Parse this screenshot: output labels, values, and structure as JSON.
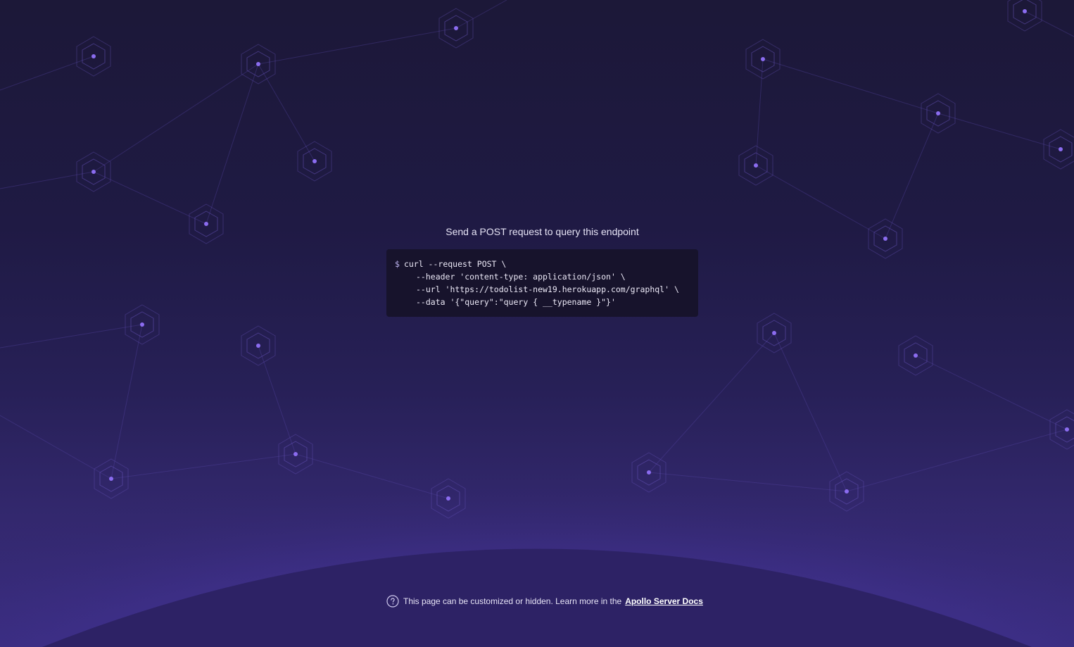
{
  "main": {
    "headline": "Send a POST request to query this endpoint",
    "code": {
      "prompt": "$",
      "lines": [
        "curl --request POST \\",
        "--header 'content-type: application/json' \\",
        "--url 'https://todolist-new19.herokuapp.com/graphql' \\",
        "--data '{\"query\":\"query { __typename }\"}'"
      ]
    }
  },
  "footer": {
    "icon": "question-circle-icon",
    "text": "This page can be customized or hidden. Learn more in the",
    "link_label": "Apollo Server Docs"
  },
  "colors": {
    "background_top": "#1c1838",
    "background_bottom": "#3a2d80",
    "node_accent": "#8b6cf0",
    "code_background": "#17132c"
  }
}
